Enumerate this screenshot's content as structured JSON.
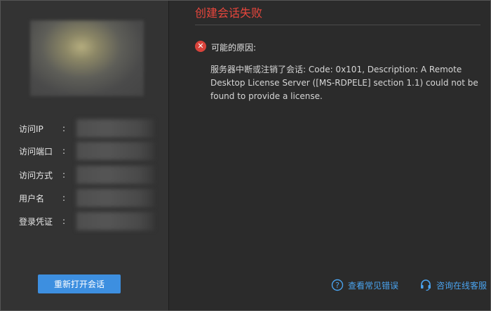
{
  "title": "创建会话失败",
  "reason_label": "可能的原因:",
  "error_message": "服务器中断或注销了会话: Code: 0x101, Description: A Remote Desktop License Server ([MS-RDPELE] section 1.1) could not be found to provide a license.",
  "info": {
    "colon": ":",
    "fields": [
      {
        "label": "访问IP"
      },
      {
        "label": "访问端口"
      },
      {
        "label": "访问方式"
      },
      {
        "label": "用户名"
      },
      {
        "label": "登录凭证"
      }
    ]
  },
  "reopen_button": "重新打开会话",
  "links": {
    "faq": "查看常见错误",
    "support": "咨询在线客服"
  },
  "colors": {
    "background": "#2b2b2b",
    "left_panel": "#333333",
    "title": "#e8463c",
    "error_icon": "#d9433b",
    "button": "#3d8fe0",
    "link": "#4aa3ef"
  },
  "icons": {
    "error": "error-circle-icon",
    "faq": "question-circle-icon",
    "support": "headset-icon"
  }
}
